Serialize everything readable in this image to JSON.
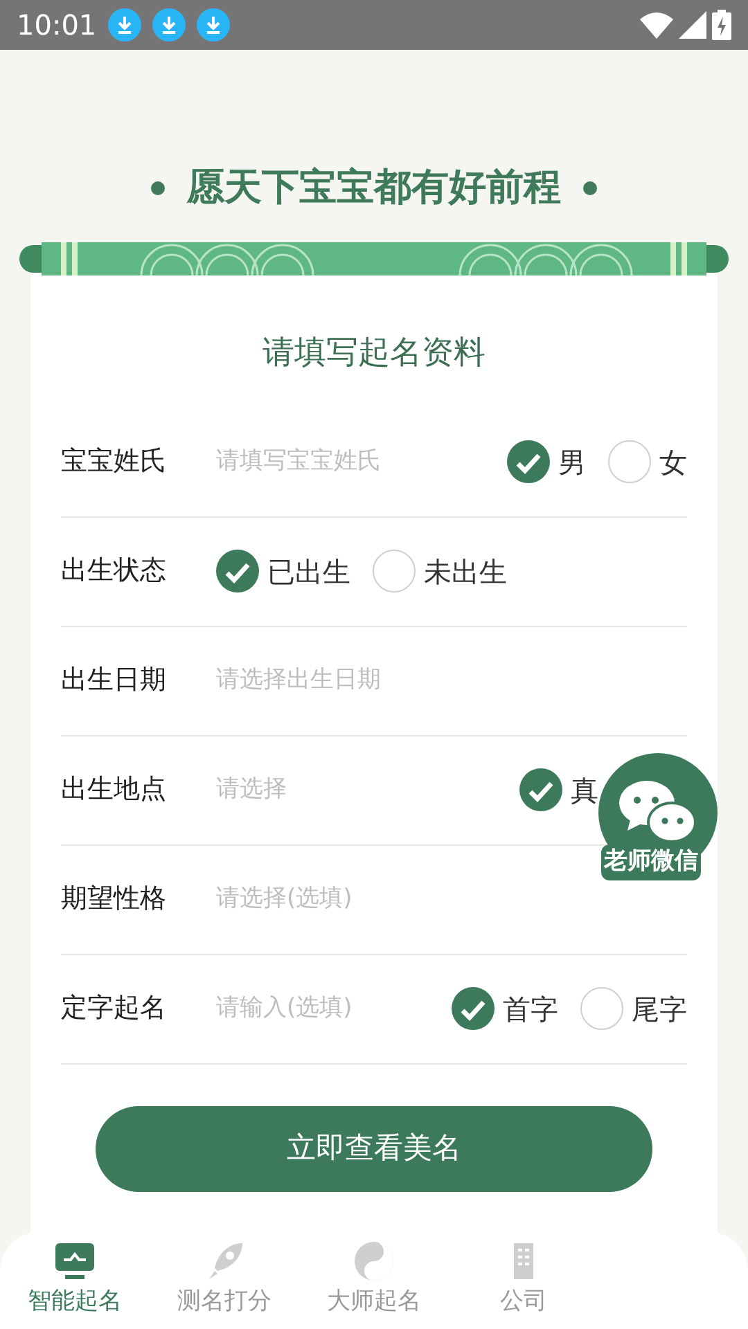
{
  "status_bar": {
    "time": "10:01"
  },
  "banner": {
    "title": "愿天下宝宝都有好前程"
  },
  "form": {
    "heading": "请填写起名资料",
    "rows": [
      {
        "label": "宝宝姓氏",
        "placeholder": "请填写宝宝姓氏",
        "options": [
          {
            "label": "男",
            "selected": true
          },
          {
            "label": "女",
            "selected": false
          }
        ]
      },
      {
        "label": "出生状态",
        "options": [
          {
            "label": "已出生",
            "selected": true
          },
          {
            "label": "未出生",
            "selected": false
          }
        ]
      },
      {
        "label": "出生日期",
        "placeholder": "请选择出生日期"
      },
      {
        "label": "出生地点",
        "placeholder": "请选择",
        "options": [
          {
            "label": "真",
            "selected": true
          }
        ]
      },
      {
        "label": "期望性格",
        "placeholder": "请选择(选填)"
      },
      {
        "label": "定字起名",
        "placeholder": "请输入(选填)",
        "options": [
          {
            "label": "首字",
            "selected": true
          },
          {
            "label": "尾字",
            "selected": false
          }
        ]
      }
    ],
    "submit": "立即查看美名"
  },
  "float_button": {
    "label": "老师微信"
  },
  "bottom_nav": [
    {
      "label": "智能起名",
      "selected": true
    },
    {
      "label": "测名打分",
      "selected": false
    },
    {
      "label": "大师起名",
      "selected": false
    },
    {
      "label": "公司",
      "selected": false
    }
  ]
}
